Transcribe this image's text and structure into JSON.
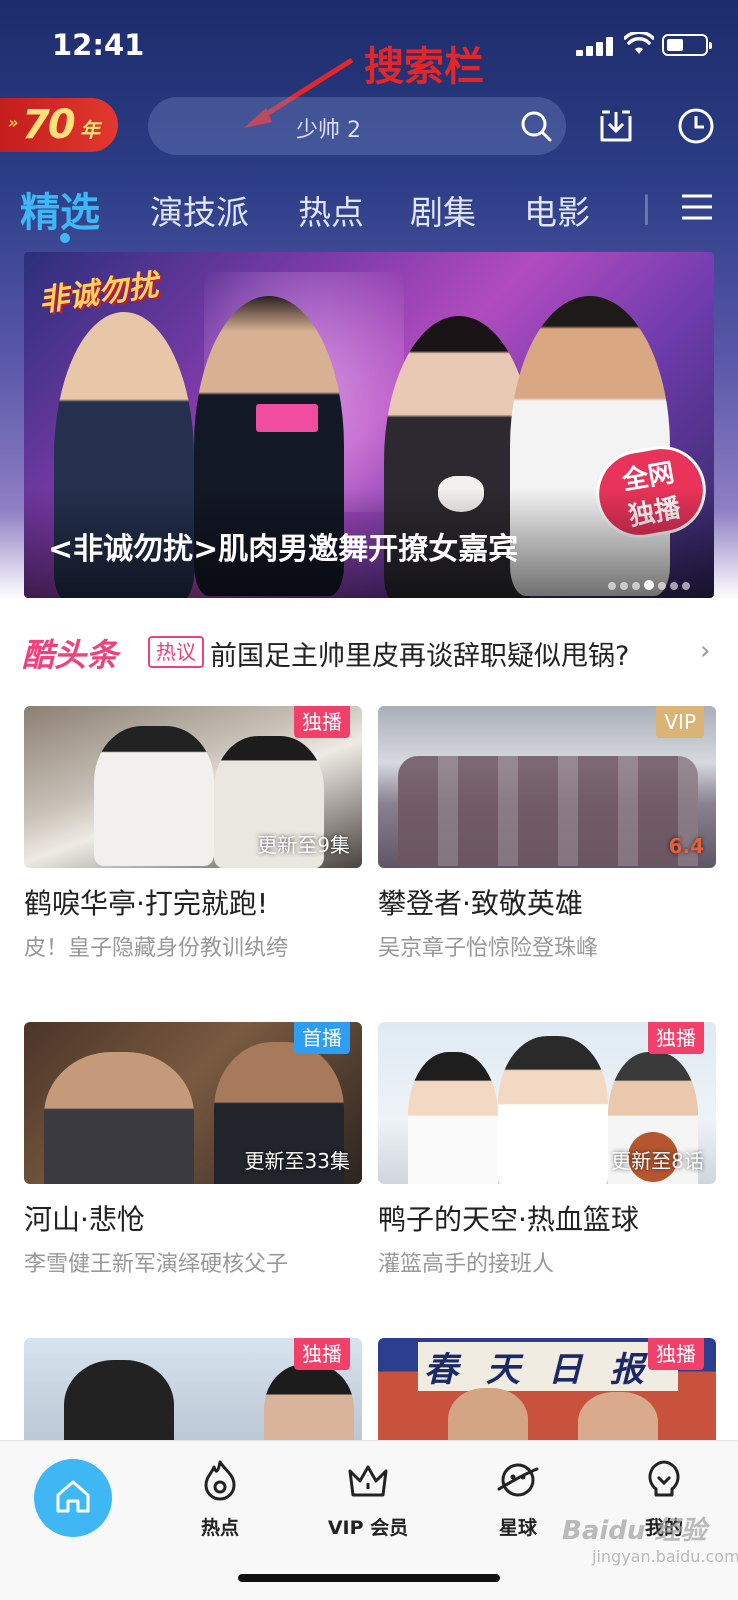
{
  "status_bar": {
    "time": "12:41"
  },
  "annotation": {
    "label": "搜索栏"
  },
  "logo": {
    "arrows": "»",
    "number": "70",
    "suffix": "年"
  },
  "search": {
    "placeholder": "少帅 2"
  },
  "tabs": [
    {
      "label": "精选",
      "active": true
    },
    {
      "label": "演技派"
    },
    {
      "label": "热点"
    },
    {
      "label": "剧集"
    },
    {
      "label": "电影"
    }
  ],
  "banner": {
    "show_logo": "非诚勿扰",
    "exclusive_line1": "全网",
    "exclusive_line2": "独播",
    "caption": "<非诚勿扰>肌肉男邀舞开撩女嘉宾",
    "dots_total": 7,
    "dots_active": 3
  },
  "headline": {
    "brand": "酷头条",
    "tag": "热议",
    "text": "前国足主帅里皮再谈辞职疑似甩锅?"
  },
  "cards": [
    {
      "badge": "独播",
      "badge_color": "#f1406a",
      "episode": "更新至9集",
      "title": "鹤唳华亭·打完就跑!",
      "sub": "皮！皇子隐藏身份教训纨绔"
    },
    {
      "badge": "VIP",
      "badge_color": "#d9b474",
      "episode": "",
      "title": "攀登者·致敬英雄",
      "sub": "吴京章子怡惊险登珠峰"
    },
    {
      "badge": "首播",
      "badge_color": "#2e9ef2",
      "episode": "更新至33集",
      "title": "河山·悲怆",
      "sub": "李雪健王新军演绎硬核父子"
    },
    {
      "badge": "独播",
      "badge_color": "#f1406a",
      "episode": "更新至8话",
      "title": "鸭子的天空·热血篮球",
      "sub": "灌篮高手的接班人"
    },
    {
      "badge": "独播",
      "badge_color": "#f1406a",
      "episode": "",
      "title": "",
      "sub": ""
    },
    {
      "badge": "独播",
      "badge_color": "#f1406a",
      "episode": "",
      "title": "",
      "sub": "",
      "poster_text": "春天日报"
    }
  ],
  "bottom_nav": [
    {
      "label": "",
      "icon": "home-icon"
    },
    {
      "label": "热点",
      "icon": "flame-icon"
    },
    {
      "label": "VIP 会员",
      "icon": "crown-icon"
    },
    {
      "label": "星球",
      "icon": "planet-icon"
    },
    {
      "label": "我的",
      "icon": "bulb-icon"
    }
  ],
  "watermark": {
    "text": "Baidu 经验",
    "sub": "jingyan.baidu.com"
  },
  "colors": {
    "accent": "#3fb7f5",
    "brand_pink": "#f1407c",
    "header_dark": "#1d2c6a"
  }
}
